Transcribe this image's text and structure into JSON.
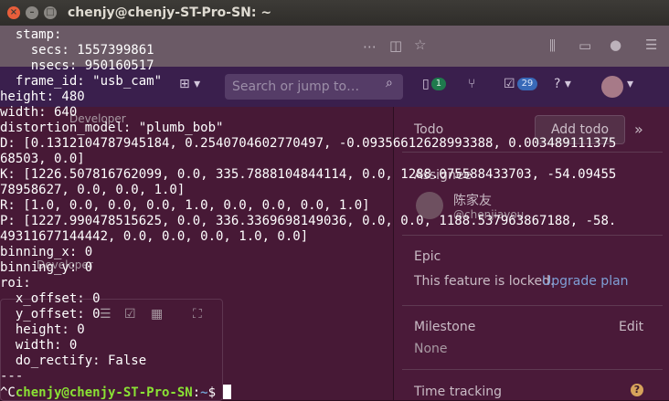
{
  "window": {
    "title": "chenjy@chenjy-ST-Pro-SN: ~",
    "close_glyph": "×",
    "min_glyph": "–",
    "max_glyph": "□"
  },
  "background_browser": {
    "search_placeholder": "Search or jump to…",
    "merge_count": "1",
    "todo_count": "29",
    "help_glyph": "?",
    "faded_labels": [
      "Developer",
      "Developer"
    ],
    "sidebar": {
      "todo_label": "Todo",
      "add_todo_label": "Add todo",
      "collapse_glyph": "»",
      "assignee_label": "Assignee",
      "assignee_name": "陈家友",
      "assignee_handle": "@chenjiayou",
      "epic_label": "Epic",
      "epic_locked_text": "This feature is locked.",
      "upgrade_link": "Upgrade plan",
      "milestone_label": "Milestone",
      "milestone_edit": "Edit",
      "milestone_value": "None",
      "time_tracking_label": "Time tracking"
    }
  },
  "terminal": {
    "lines": [
      "  stamp:",
      "    secs: 1557399861",
      "    nsecs: 950160517",
      "  frame_id: \"usb_cam\"",
      "height: 480",
      "width: 640",
      "distortion_model: \"plumb_bob\"",
      "D: [0.1312104787945184, 0.2540704602770497, -0.09356612628993388, 0.003489111375",
      "68503, 0.0]",
      "K: [1226.507816762099, 0.0, 335.7888104844114, 0.0, 1288.075588433703, -54.09455",
      "78958627, 0.0, 0.0, 1.0]",
      "R: [1.0, 0.0, 0.0, 0.0, 1.0, 0.0, 0.0, 0.0, 1.0]",
      "P: [1227.990478515625, 0.0, 336.3369698149036, 0.0, 0.0, 1188.537963867188, -58.",
      "49311677144442, 0.0, 0.0, 0.0, 1.0, 0.0]",
      "binning_x: 0",
      "binning_y: 0",
      "roi:",
      "  x_offset: 0",
      "  y_offset: 0",
      "  height: 0",
      "  width: 0",
      "  do_rectify: False",
      "---"
    ],
    "prompt": {
      "prefix": "^C",
      "user_host": "chenjy@chenjy-ST-Pro-SN",
      "path_sep": ":",
      "path": "~",
      "dollar": "$ "
    },
    "colors": {
      "text": "#ffffff",
      "user": "#8ae234",
      "path": "#729fcf",
      "background": "#2c0f22"
    }
  }
}
